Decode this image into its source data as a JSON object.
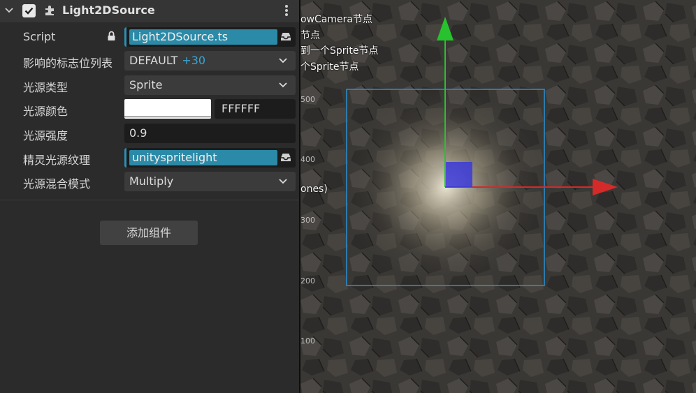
{
  "component": {
    "title": "Light2DSource",
    "enabled": true
  },
  "properties": {
    "script": {
      "label": "Script",
      "value": "Light2DSource.ts"
    },
    "layers": {
      "label": "影响的标志位列表",
      "value": "DEFAULT",
      "extra": "+30"
    },
    "light_type": {
      "label": "光源类型",
      "value": "Sprite"
    },
    "light_color": {
      "label": "光源颜色",
      "hex": "FFFFFF",
      "swatch": "#ffffff"
    },
    "intensity": {
      "label": "光源强度",
      "value": "0.9"
    },
    "sprite_texture": {
      "label": "精灵光源纹理",
      "value": "unityspritelight"
    },
    "blend_mode": {
      "label": "光源混合模式",
      "value": "Multiply"
    }
  },
  "add_component_label": "添加组件",
  "scene": {
    "overlay_lines": [
      "owCamera节点",
      "节点",
      "到一个Sprite节点",
      "个Sprite节点"
    ],
    "partial_text": "ones)",
    "axis_ticks": [
      "500",
      "400",
      "300",
      "200",
      "100"
    ]
  },
  "colors": {
    "accent": "#2b8aa7",
    "count": "#36a6d6",
    "gizmo_y": "#27c22e",
    "gizmo_x": "#d42a2a",
    "gizmo_center": "#3a3ad8",
    "bounds": "#2a8fd4"
  }
}
